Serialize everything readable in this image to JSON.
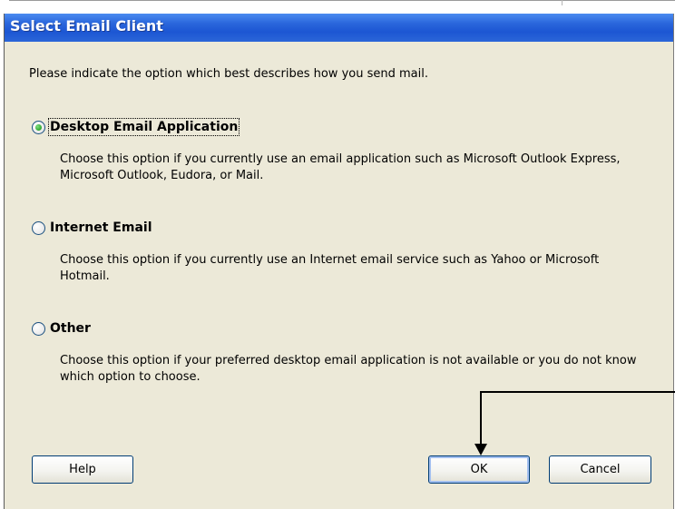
{
  "dialog": {
    "title": "Select Email Client",
    "instruction": "Please indicate the option which best describes how you send mail.",
    "options": [
      {
        "label": "Desktop Email Application",
        "selected": true,
        "description": "Choose this option if you currently use an email application such as Microsoft Outlook Express, Microsoft Outlook, Eudora, or Mail."
      },
      {
        "label": "Internet Email",
        "selected": false,
        "description": "Choose this option if you currently use an Internet email service such as Yahoo or Microsoft Hotmail."
      },
      {
        "label": "Other",
        "selected": false,
        "description": "Choose this option if your preferred desktop email application is not available or you do not know which option to choose."
      }
    ],
    "buttons": {
      "help": "Help",
      "ok": "OK",
      "cancel": "Cancel"
    }
  },
  "colors": {
    "titlebar": "#2a66dc",
    "dialog_bg": "#ece9d8",
    "radio_selected": "#2fa52f",
    "button_border": "#003c74"
  }
}
